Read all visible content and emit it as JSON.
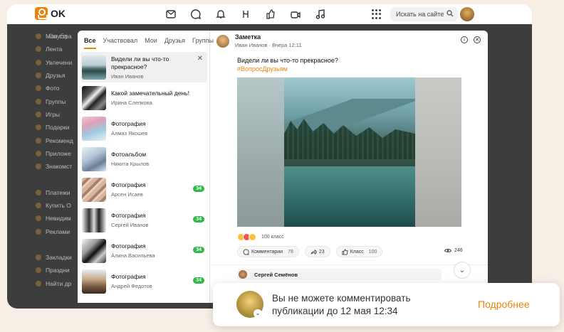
{
  "topbar": {
    "logo_text": "OK",
    "search_placeholder": "Искать на сайте",
    "icons": [
      "mail-icon",
      "chat-icon",
      "bell-icon",
      "friends-icon",
      "like-icon",
      "video-icon",
      "music-icon"
    ]
  },
  "background_sidebar": {
    "profile_label": "Опубл",
    "items": [
      "Мои стра",
      "Лента",
      "Увлечени",
      "Друзья",
      "Фото",
      "Группы",
      "Игры",
      "Подарки",
      "Рекоменд",
      "Приложе",
      "Знакомст",
      "",
      "Платежи",
      "Купить О",
      "Невидим",
      "Реклами",
      "",
      "Закладки",
      "Праздни",
      "Найти др"
    ]
  },
  "left_panel": {
    "tabs": [
      "Все",
      "Участвовал",
      "Мои",
      "Друзья",
      "Группы"
    ],
    "active_tab": "Все",
    "items": [
      {
        "title": "Видели ли вы что-то прекрасное?",
        "author": "Иван Иванов",
        "badge": "",
        "selected": true
      },
      {
        "title": "Какой замечательный день!",
        "author": "Ирина Слепкова",
        "badge": ""
      },
      {
        "title": "Фотография",
        "author": "Алмаз Якошев",
        "badge": ""
      },
      {
        "title": "Фотоальбом",
        "author": "Никита Крылов",
        "badge": ""
      },
      {
        "title": "Фотография",
        "author": "Арсен Исаев",
        "badge": "34"
      },
      {
        "title": "Фотография",
        "author": "Сергей Иванов",
        "badge": "34"
      },
      {
        "title": "Фотография",
        "author": "Алина Васильева",
        "badge": "34"
      },
      {
        "title": "Фотография",
        "author": "Андрей Федотов",
        "badge": "34"
      }
    ]
  },
  "post": {
    "type_label": "Заметка",
    "author": "Иван Иванов",
    "time": "Вчера 12:11",
    "text": "Видели ли вы что-то прекрасное?",
    "hashtag": "#ВопросДрузьям",
    "reactions_count": "100 класс",
    "actions": {
      "comments_label": "Комментарии",
      "comments_count": "78",
      "shares_count": "23",
      "likes_label": "Класс",
      "likes_count": "100"
    },
    "views": "246"
  },
  "comment": {
    "author": "Сергей Семёнов"
  },
  "toast": {
    "text": "Вы не можете комментировать публикации до 12 мая 12:34",
    "action": "Подробнее"
  },
  "colors": {
    "accent": "#ee8208",
    "badge": "#30b849",
    "background": "#f7eee5"
  }
}
